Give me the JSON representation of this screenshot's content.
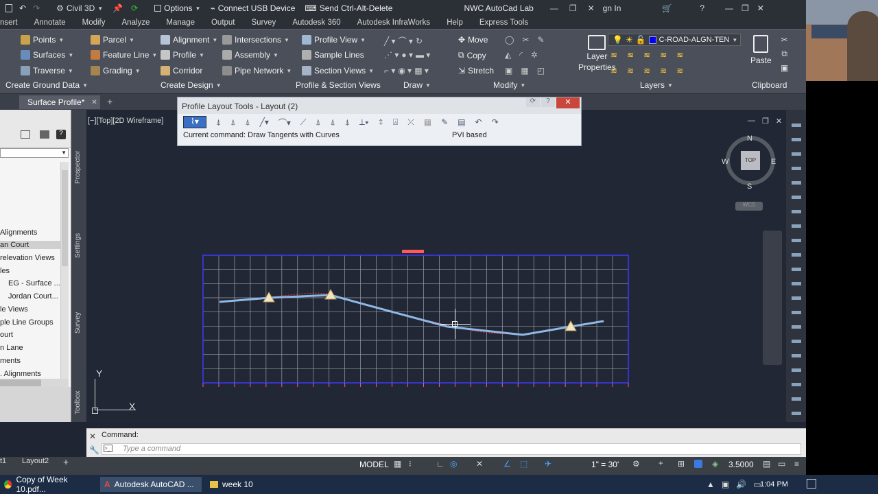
{
  "topbar": {
    "app": "Civil 3D",
    "options": "Options",
    "usb": "Connect USB Device",
    "ctrl_alt_del": "Send Ctrl-Alt-Delete",
    "title": "NWC AutoCad Lab",
    "sign_in": "gn In"
  },
  "menu_tabs": [
    "nsert",
    "Annotate",
    "Modify",
    "Analyze",
    "Manage",
    "Output",
    "Survey",
    "Autodesk 360",
    "Autodesk InfraWorks",
    "Help",
    "Express Tools"
  ],
  "ribbon": {
    "ground": {
      "points": "Points",
      "surfaces": "Surfaces",
      "traverse": "Traverse",
      "label": "Create Ground Data"
    },
    "design": {
      "parcel": "Parcel",
      "feature_line": "Feature Line",
      "grading": "Grading",
      "alignment": "Alignment",
      "profile": "Profile",
      "corridor": "Corridor",
      "intersections": "Intersections",
      "assembly": "Assembly",
      "pipe_network": "Pipe Network",
      "label": "Create Design"
    },
    "profile_section": {
      "profile_view": "Profile View",
      "sample_lines": "Sample Lines",
      "section_views": "Section Views",
      "label": "Profile & Section Views"
    },
    "draw": {
      "label": "Draw"
    },
    "modify": {
      "move": "Move",
      "copy": "Copy",
      "stretch": "Stretch",
      "label": "Modify"
    },
    "layers": {
      "layer_properties_1": "Layer",
      "layer_properties_2": "Properties",
      "current_layer": "C-ROAD-ALGN-TEN",
      "label": "Layers"
    },
    "clipboard": {
      "paste": "Paste",
      "label": "Clipboard"
    }
  },
  "doc_tab": "Surface Profile*",
  "viewport_label": "[−][Top][2D Wireframe]",
  "profile_tools": {
    "title": "Profile Layout Tools - Layout (2)",
    "command": "Current command: Draw Tangents with Curves",
    "mode": "PVI based"
  },
  "left_panel": {
    "side_tabs": [
      "Prospector",
      "Settings",
      "Survey",
      "Toolbox"
    ],
    "items": [
      "Alignments",
      "an Court",
      "relevation Views",
      "les",
      "EG - Surface ...",
      "Jordan Court...",
      "le Views",
      "ple Line Groups",
      "ourt",
      "n Lane",
      "ments",
      ". Alignments"
    ]
  },
  "viewcube": {
    "n": "N",
    "s": "S",
    "e": "E",
    "w": "W",
    "top": "TOP",
    "wcs": "WCS"
  },
  "ucs": {
    "x": "X",
    "y": "Y"
  },
  "command": {
    "label": "Command:",
    "placeholder": "Type  a  command"
  },
  "status": {
    "model": "MODEL",
    "scale": "1\" = 30'",
    "value": "3.5000",
    "layout_tab": "Layout2",
    "layout_prev": "t1"
  },
  "taskbar": {
    "item1": "Copy of Week 10.pdf...",
    "item2": "Autodesk AutoCAD ...",
    "item3": "week 10",
    "time": "1:04 PM"
  }
}
